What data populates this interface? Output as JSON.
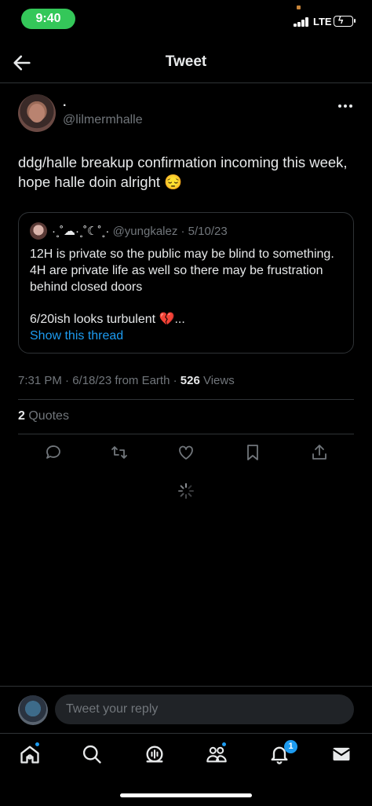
{
  "status_bar": {
    "time": "9:40",
    "network": "LTE"
  },
  "header": {
    "title": "Tweet",
    "back_icon": "arrow-left-icon"
  },
  "tweet": {
    "display_name": "·",
    "handle": "@lilmermhalle",
    "text": "ddg/halle breakup confirmation incoming this week, hope halle doin alright 😔",
    "timestamp": "7:31 PM · 6/18/23 from Earth · ",
    "views_count": "526",
    "views_label": " Views",
    "quotes_count": "2",
    "quotes_label": " Quotes"
  },
  "quoted_tweet": {
    "display_name": "·˳˚☁︎·˳˚☾˚˳·",
    "handle_date": " @yungkalez · 5/10/23",
    "lines": [
      "12H is private so the public may be blind to something.",
      "4H are private life as well so there may be frustration behind closed doors",
      "6/20ish looks turbulent 💔..."
    ],
    "show_thread": "Show this thread"
  },
  "actions": [
    "reply-icon",
    "retweet-icon",
    "like-icon",
    "bookmark-icon",
    "share-icon"
  ],
  "reply_bar": {
    "placeholder": "Tweet your reply"
  },
  "tab_bar": {
    "items": [
      "home-icon",
      "search-icon",
      "spaces-icon",
      "communities-icon",
      "notifications-icon",
      "messages-icon"
    ],
    "notifications_badge": "1"
  },
  "colors": {
    "accent": "#1d9bf0",
    "background": "#000000",
    "status_pill": "#34c759",
    "secondary_text": "#71767b"
  }
}
